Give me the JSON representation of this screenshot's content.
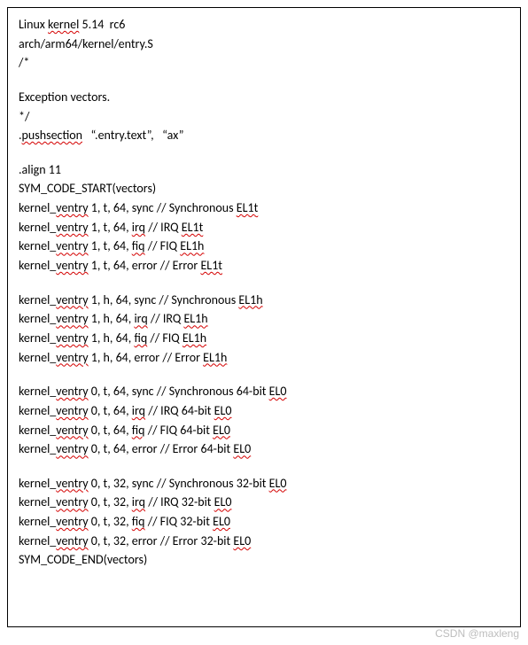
{
  "header": {
    "l1a": "Linux ",
    "l1b": "kernel",
    "l1c": " 5.14  rc6",
    "l2": "arch/arm64/kernel/entry.S",
    "l3": "/*",
    "l4": "Exception vectors.",
    "l5": "*/",
    "l6a": ".",
    "l6b": "pushsection",
    "l6c": "   “.entry.text”,   “ax”",
    "l7": ".align 11",
    "l8": "SYM_CODE_START(vectors)"
  },
  "v1": {
    "a": {
      "pre": "kernel_",
      "mid": "ventry",
      "post": " 1, t, 64, sync // Synchronous ",
      "tail": "EL1t"
    },
    "b": {
      "pre": "kernel_",
      "mid": "ventry",
      "post": " 1, t, 64, ",
      "irq": "irq",
      "c": " // IRQ ",
      "tail": "EL1t"
    },
    "c": {
      "pre": "kernel_",
      "mid": "ventry",
      "post": " 1, t, 64, ",
      "fiq": "fiq",
      "c": " // FIQ ",
      "tail": "EL1h"
    },
    "d": {
      "pre": "kernel_",
      "mid": "ventry",
      "post": " 1, t, 64, error // Error ",
      "tail": "EL1t"
    }
  },
  "v2": {
    "a": {
      "pre": "kernel_",
      "mid": "ventry",
      "post": " 1, h, 64, sync // Synchronous ",
      "tail": "EL1h"
    },
    "b": {
      "pre": "kernel_",
      "mid": "ventry",
      "post": " 1, h, 64, ",
      "irq": "irq",
      "c": " // IRQ ",
      "tail": "EL1h"
    },
    "c": {
      "pre": "kernel_",
      "mid": "ventry",
      "post": " 1, h, 64, ",
      "fiq": "fiq",
      "c": " // FIQ ",
      "tail": "EL1h"
    },
    "d": {
      "pre": "kernel_",
      "mid": "ventry",
      "post": " 1, h, 64, error // Error ",
      "tail": "EL1h"
    }
  },
  "v3": {
    "a": {
      "pre": "kernel_",
      "mid": "ventry",
      "post": " 0, t, 64, sync // Synchronous 64-bit ",
      "tail": "EL0"
    },
    "b": {
      "pre": "kernel_",
      "mid": "ventry",
      "post": " 0, t, 64, ",
      "irq": "irq",
      "c": " // IRQ 64-bit ",
      "tail": "EL0"
    },
    "c": {
      "pre": "kernel_",
      "mid": "ventry",
      "post": " 0, t, 64, ",
      "fiq": "fiq",
      "c": " // FIQ 64-bit ",
      "tail": "EL0"
    },
    "d": {
      "pre": "kernel_",
      "mid": "ventry",
      "post": " 0, t, 64, error // Error 64-bit ",
      "tail": "EL0"
    }
  },
  "v4": {
    "a": {
      "pre": "kernel_",
      "mid": "ventry",
      "post": " 0, t, 32, sync // Synchronous 32-bit ",
      "tail": "EL0"
    },
    "b": {
      "pre": "kernel_",
      "mid": "ventry",
      "post": " 0, t, 32, ",
      "irq": "irq",
      "c": " // IRQ 32-bit ",
      "tail": "EL0"
    },
    "c": {
      "pre": "kernel_",
      "mid": "ventry",
      "post": " 0, t, 32, ",
      "fiq": "fiq",
      "c": " // FIQ 32-bit ",
      "tail": "EL0"
    },
    "d": {
      "pre": "kernel_",
      "mid": "ventry",
      "post": " 0, t, 32, error // Error 32-bit ",
      "tail": "EL0"
    }
  },
  "footer": {
    "end": "SYM_CODE_END(vectors)"
  },
  "watermark": "CSDN @maxleng"
}
